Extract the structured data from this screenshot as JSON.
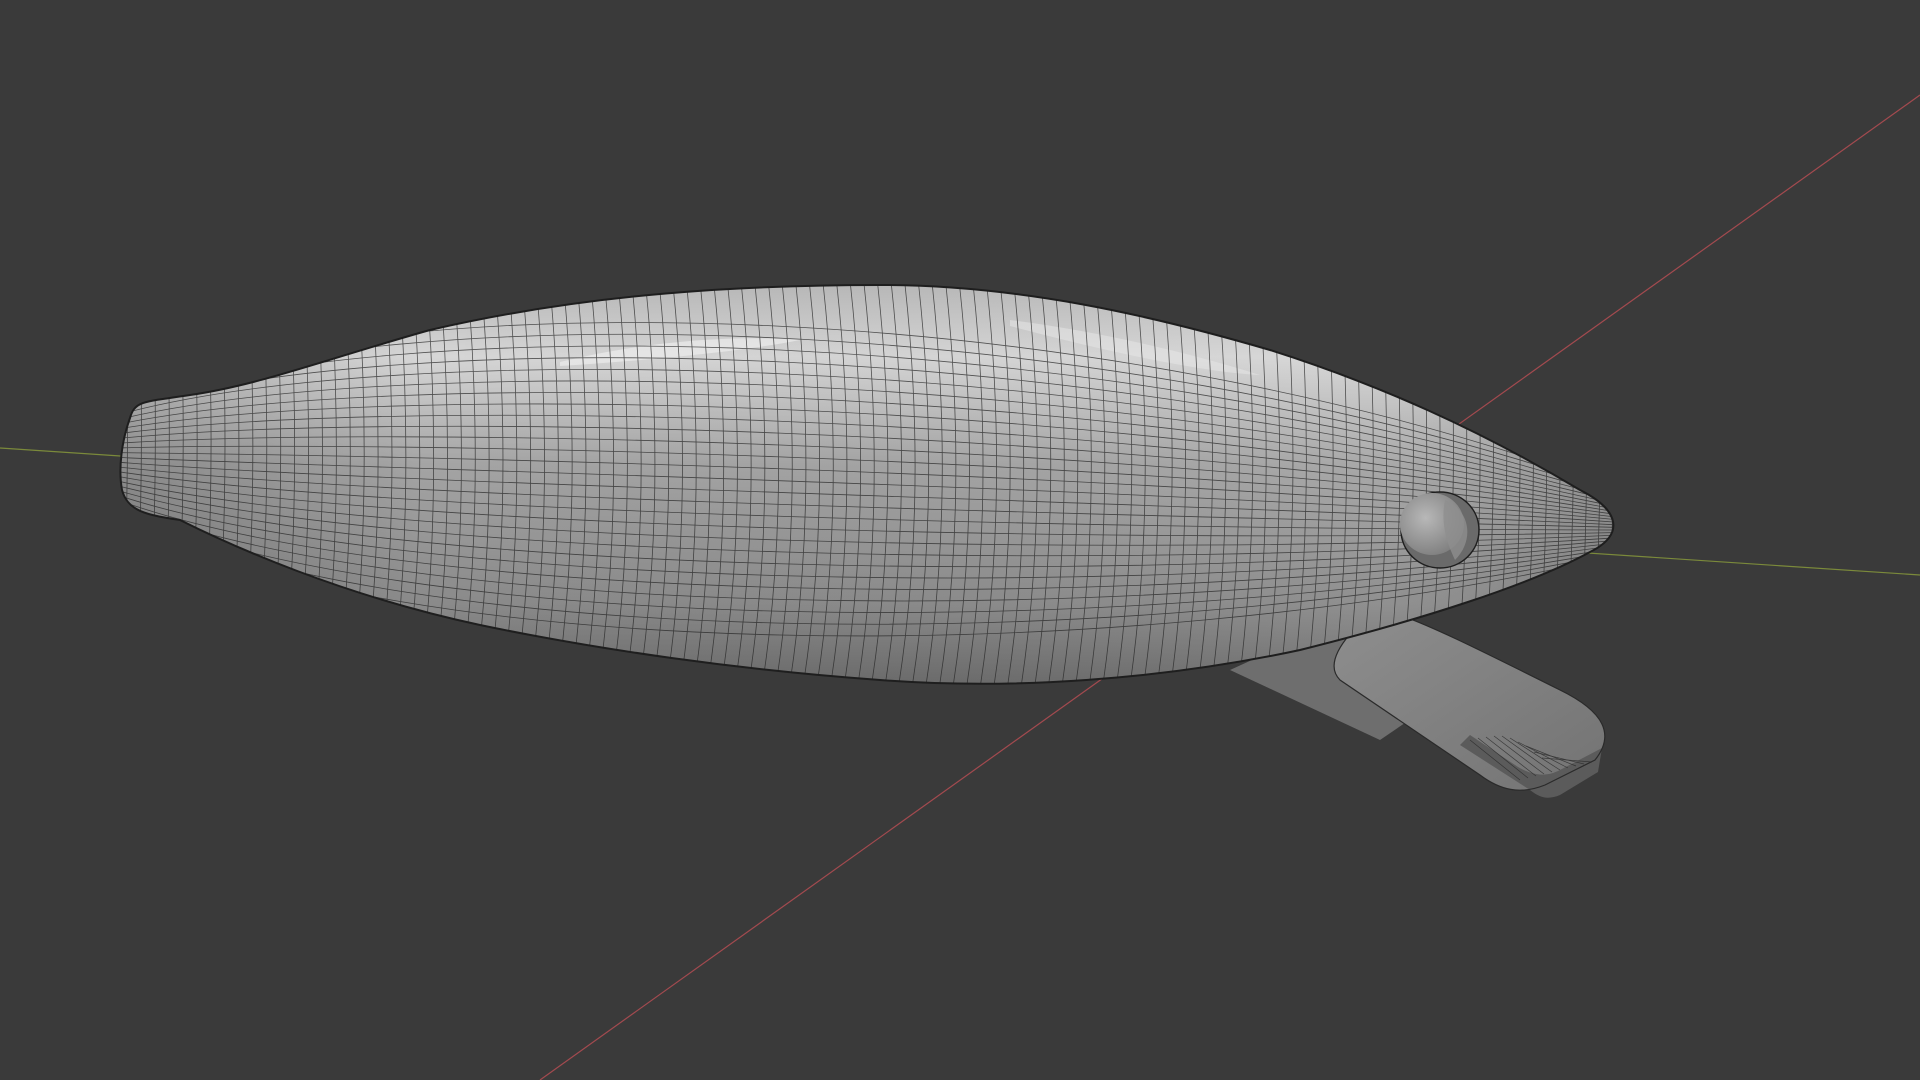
{
  "app": {
    "panel": "3D Viewport",
    "shading": "solid",
    "overlay": "wireframe"
  },
  "colors": {
    "background": "#3a3a3a",
    "x_axis": "#a34a4f",
    "y_axis": "#7b8a3b",
    "mesh_light": "#cfcfcf",
    "mesh_mid": "#9b9b9b",
    "mesh_dark": "#5f5f5f",
    "wire": "#1e1e1e"
  },
  "scene": {
    "objects": [
      {
        "name": "lure-body",
        "kind": "mesh"
      },
      {
        "name": "lure-eye",
        "kind": "mesh"
      },
      {
        "name": "diving-lip",
        "kind": "mesh"
      }
    ],
    "axes": [
      "x-axis-line",
      "y-axis-line"
    ]
  }
}
